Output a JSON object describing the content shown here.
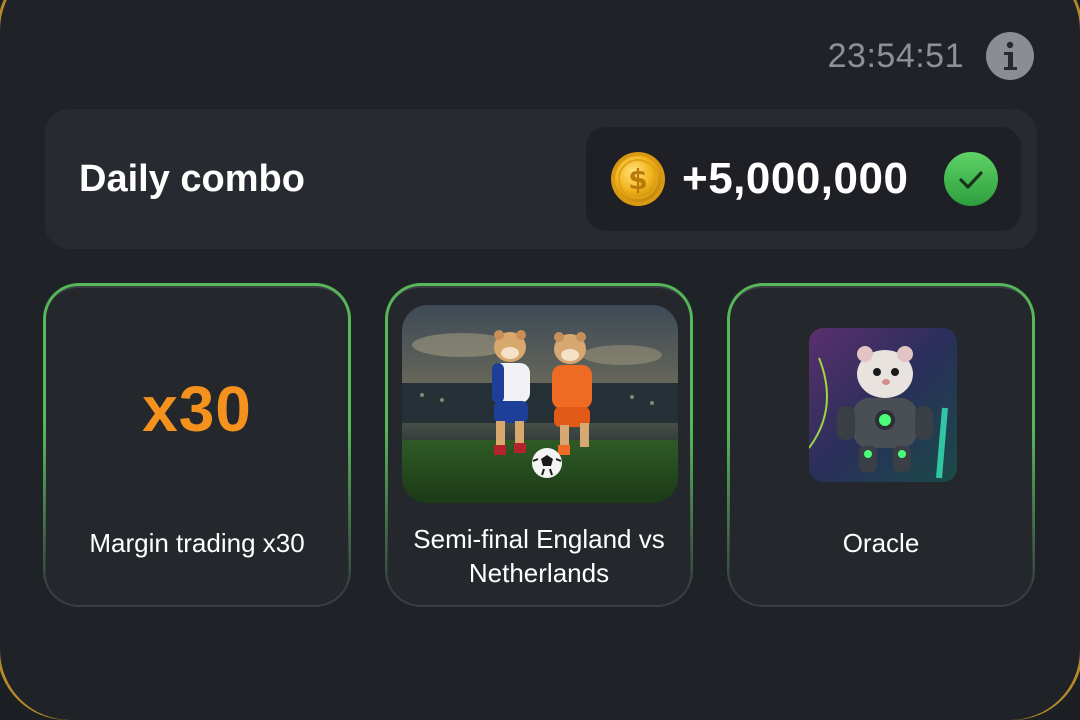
{
  "header": {
    "timer": "23:54:51",
    "info_icon": "info-icon"
  },
  "combo": {
    "title": "Daily combo",
    "reward": "+5,000,000",
    "coin_icon": "coin-icon",
    "status_icon": "check-icon",
    "status": "completed"
  },
  "cards": [
    {
      "badge": "x30",
      "label": "Margin trading x30"
    },
    {
      "image": "football-hamsters-image",
      "label": "Semi-final England vs Netherlands"
    },
    {
      "image": "robot-hamster-image",
      "label": "Oracle"
    }
  ],
  "colors": {
    "background": "#1f2227",
    "panel": "#272a30",
    "card_border": "#57b85a",
    "accent_orange": "#f5921e",
    "check_green": "#3fb54a",
    "coin_gold": "#f2b51d",
    "frame_gold": "#b68a2a"
  }
}
